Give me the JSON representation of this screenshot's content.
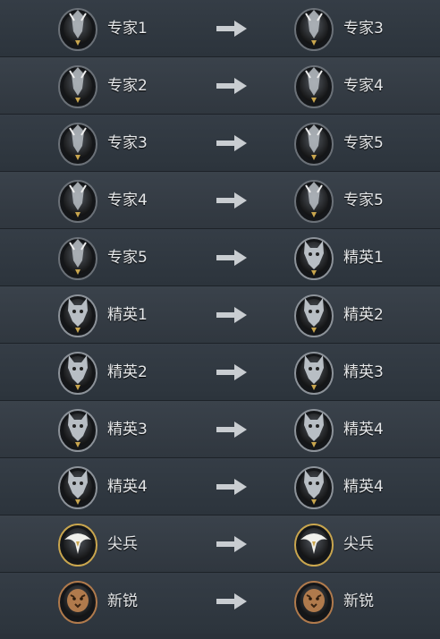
{
  "rows": [
    {
      "from": {
        "label": "专家1",
        "badge": "specialist-badge-icon"
      },
      "to": {
        "label": "专家3",
        "badge": "specialist-badge-icon"
      }
    },
    {
      "from": {
        "label": "专家2",
        "badge": "specialist-badge-icon"
      },
      "to": {
        "label": "专家4",
        "badge": "specialist-badge-icon"
      }
    },
    {
      "from": {
        "label": "专家3",
        "badge": "specialist-badge-icon"
      },
      "to": {
        "label": "专家5",
        "badge": "specialist-badge-icon"
      }
    },
    {
      "from": {
        "label": "专家4",
        "badge": "specialist-badge-icon"
      },
      "to": {
        "label": "专家5",
        "badge": "specialist-badge-icon"
      }
    },
    {
      "from": {
        "label": "专家5",
        "badge": "specialist-badge-icon"
      },
      "to": {
        "label": "精英1",
        "badge": "elite-wolf-badge-icon"
      }
    },
    {
      "from": {
        "label": "精英1",
        "badge": "elite-wolf-badge-icon"
      },
      "to": {
        "label": "精英2",
        "badge": "elite-wolf-badge-icon"
      }
    },
    {
      "from": {
        "label": "精英2",
        "badge": "elite-wolf-badge-icon"
      },
      "to": {
        "label": "精英3",
        "badge": "elite-wolf-badge-icon"
      }
    },
    {
      "from": {
        "label": "精英3",
        "badge": "elite-wolf-badge-icon"
      },
      "to": {
        "label": "精英4",
        "badge": "elite-wolf-badge-icon"
      }
    },
    {
      "from": {
        "label": "精英4",
        "badge": "elite-wolf-badge-icon"
      },
      "to": {
        "label": "精英4",
        "badge": "elite-wolf-badge-icon"
      }
    },
    {
      "from": {
        "label": "尖兵",
        "badge": "eagle-badge-icon"
      },
      "to": {
        "label": "尖兵",
        "badge": "eagle-badge-icon"
      }
    },
    {
      "from": {
        "label": "新锐",
        "badge": "tiger-badge-icon"
      },
      "to": {
        "label": "新锐",
        "badge": "tiger-badge-icon"
      }
    }
  ],
  "arrow_icon": "arrow-right-icon",
  "colors": {
    "background": "#2b323a",
    "text": "#e6e8ea",
    "arrow": "#c9cdd1",
    "silver": "#b8bec4",
    "gold": "#c9a64e",
    "bronze": "#b07a4c"
  }
}
